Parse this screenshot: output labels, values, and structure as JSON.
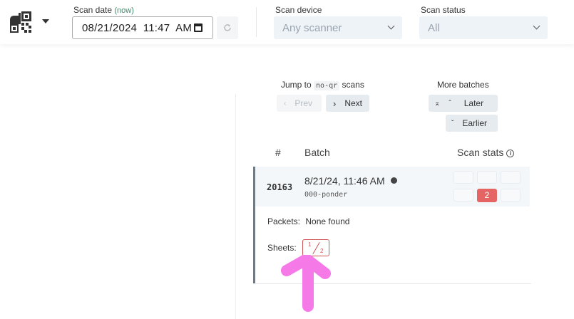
{
  "header": {
    "logo_icon": "qr-scanner-logo-icon",
    "scan_date": {
      "label": "Scan date",
      "now_link": "(now)",
      "value": "08/21/2024  11:47  AM"
    },
    "refresh_icon": "refresh-icon",
    "scan_device": {
      "label": "Scan device",
      "value": "Any scanner"
    },
    "scan_status": {
      "label": "Scan status",
      "value": "All"
    }
  },
  "navigation": {
    "jump_prefix": "Jump to",
    "jump_code": "no-qr",
    "jump_suffix": "scans",
    "prev_label": "Prev",
    "next_label": "Next",
    "more_batches_label": "More batches",
    "later_label": "Later",
    "earlier_label": "Earlier"
  },
  "table": {
    "columns": [
      "#",
      "Batch",
      "Scan stats"
    ],
    "rows": [
      {
        "number": "20163",
        "datetime": "8/21/24, 11:46 AM",
        "batch_name": "000-ponder",
        "stat_badge": "2"
      }
    ]
  },
  "details": {
    "packets_label": "Packets:",
    "packets_value": "None found",
    "sheets_label": "Sheets:",
    "sheet_numerator": "1",
    "sheet_denominator": "2"
  },
  "colors": {
    "accent_green": "#3c8a6a",
    "badge_red": "#e56565",
    "annotation_pink": "#f57ae8"
  }
}
